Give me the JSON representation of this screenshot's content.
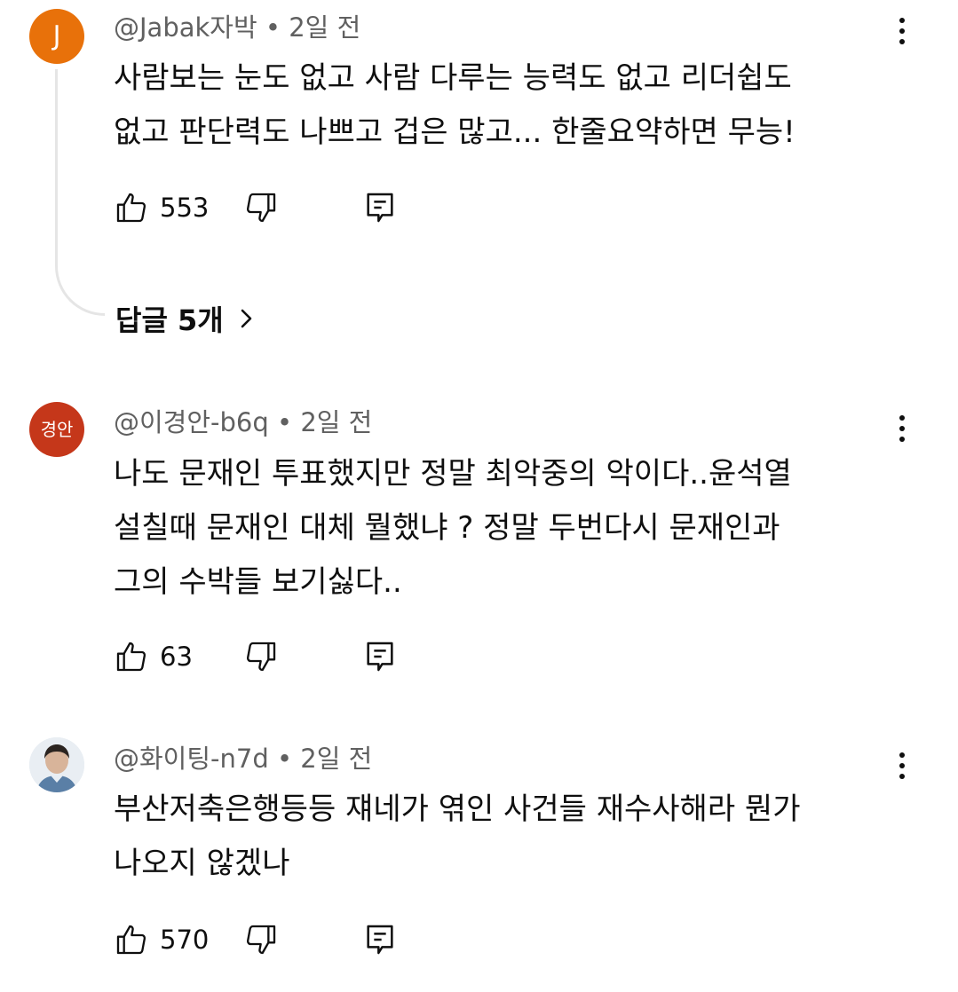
{
  "comments": [
    {
      "author": "@Jabak자박",
      "time": "2일 전",
      "avatar_text": "J",
      "avatar_color": "#e8710a",
      "text_lines": [
        "사람보는 눈도 없고 사람 다루는 능력도 없고 리더쉽도",
        "없고 판단력도 나쁘고 겁은 많고... 한줄요약하면 무능!"
      ],
      "likes": "553",
      "replies_label": "답글 5개"
    },
    {
      "author": "@이경안-b6q",
      "time": "2일 전",
      "avatar_text": "경안",
      "avatar_color": "#c5371a",
      "text_lines": [
        "나도 문재인 투표했지만 정말 최악중의 악이다..윤석열",
        "설칠때 문재인 대체 뭘했냐 ? 정말 두번다시 문재인과",
        "그의 수박들 보기싫다.."
      ],
      "likes": "63"
    },
    {
      "author": "@화이팅-n7d",
      "time": "2일 전",
      "avatar_text": "",
      "avatar_color": "#dfe7ee",
      "text_lines": [
        "부산저축은행등등 쟤네가 엮인 사건들 재수사해라 뭔가",
        "나오지 않겠나"
      ],
      "likes": "570"
    }
  ],
  "separator": " • ",
  "icons": {
    "like": "thumbs-up-icon",
    "dislike": "thumbs-down-icon",
    "reply": "reply-comment-icon",
    "more": "more-vertical-icon",
    "chevron": "chevron-right-icon"
  }
}
